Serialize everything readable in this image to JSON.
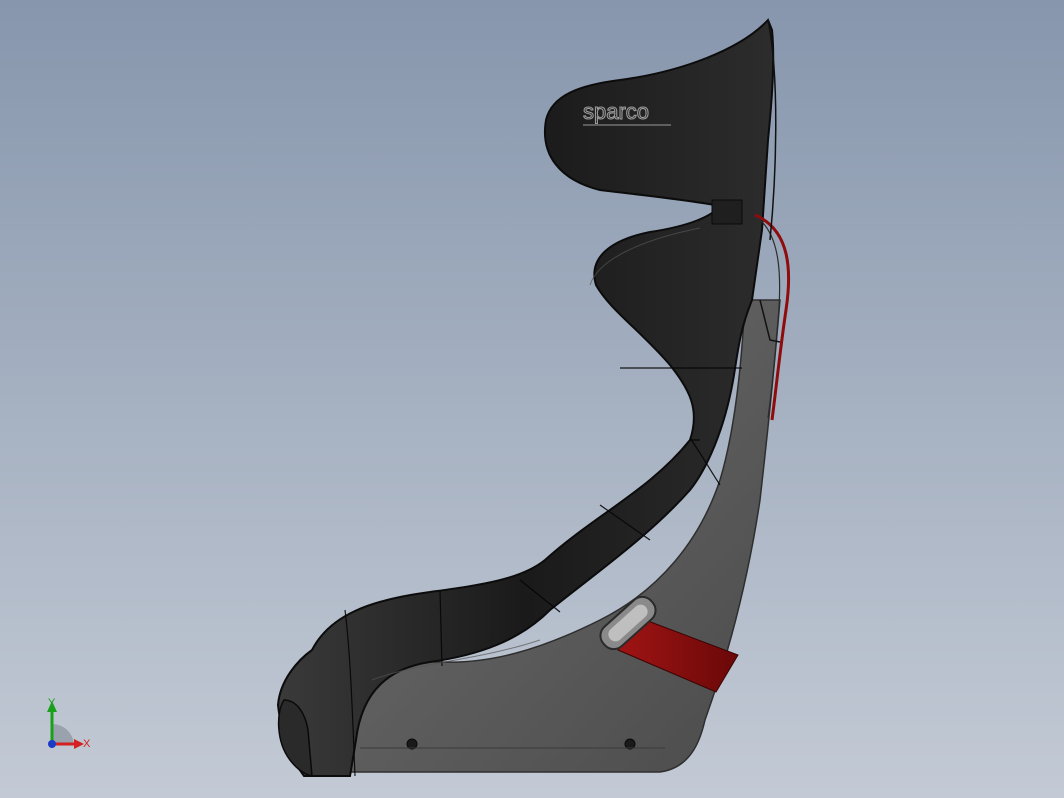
{
  "model": {
    "logo_text": "sparco"
  },
  "triad": {
    "x_label": "X",
    "y_label": "Y"
  },
  "colors": {
    "background_top": "#8796ad",
    "background_bottom": "#c3cad5",
    "seat_shell": "#1c1c1c",
    "seat_frame": "#5a5a5a",
    "harness_red": "#8e0c0c",
    "axis_x": "#d42020",
    "axis_y": "#1aa01a",
    "axis_z": "#1a3ac8"
  },
  "icons": [
    "coordinate-triad-icon"
  ]
}
